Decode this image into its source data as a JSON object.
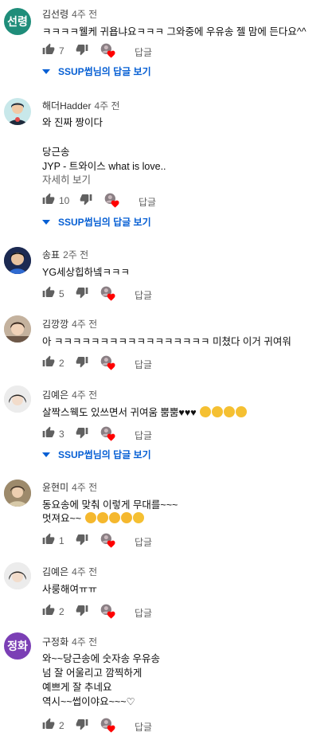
{
  "ui": {
    "reply_label": "답글"
  },
  "comments": [
    {
      "author": "김선령",
      "time": "4주 전",
      "avatar_text": "선령",
      "avatar_color": "#1f8d7a",
      "lines": [
        "ㅋㅋㅋㅋ웰케 귀욥냐요ㅋㅋㅋ 그와중에 우유송 젤 맘에 든다요^^"
      ],
      "likes": "7",
      "replies_link": "SSUP썹님의 답글 보기"
    },
    {
      "author": "해더Hadder",
      "time": "4주 전",
      "lines": [
        "와 진짜 짱이다",
        "",
        "당근송",
        "JYP - 트와이스 what is love.."
      ],
      "show_more": "자세히 보기",
      "likes": "10",
      "replies_link": "SSUP썹님의 답글 보기"
    },
    {
      "author": "송표",
      "time": "2주 전",
      "lines": [
        "YG세상힙하넼ㅋㅋㅋ"
      ],
      "likes": "5"
    },
    {
      "author": "김깡깡",
      "time": "4주 전",
      "lines": [
        "아 ㅋㅋㅋㅋㅋㅋㅋㅋㅋㅋㅋㅋㅋㅋㅋㅋㅋ 미쳤다 이거 귀여워"
      ],
      "likes": "2"
    },
    {
      "author": "김예은",
      "time": "4주 전",
      "lines": [
        "살짝스웩도 있쓰면서 귀여움 뿜뿜♥♥♥"
      ],
      "likes": "3",
      "replies_link": "SSUP썹님의 답글 보기"
    },
    {
      "author": "윤현미",
      "time": "4주 전",
      "lines": [
        "동요송에  맞춰  이렇게 무대를~~~",
        "멋져요~~"
      ],
      "likes": "1"
    },
    {
      "author": "김예은",
      "time": "4주 전",
      "lines": [
        "사룽해여ㅠㅠ"
      ],
      "likes": "2"
    },
    {
      "author": "구정화",
      "time": "4주 전",
      "avatar_text": "정화",
      "avatar_color": "#7b3fb5",
      "lines": [
        "와~~당근송에  숫자송  우유송",
        "넘  잘  어울리고  깜찍하게",
        "예쁘게  잘 추네요",
        "역시~~썹이야요~~~♡"
      ],
      "likes": "2"
    }
  ]
}
